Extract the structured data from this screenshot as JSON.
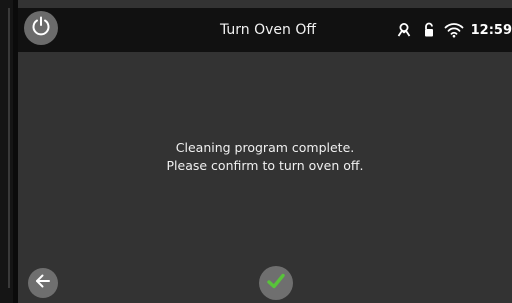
{
  "header": {
    "title": "Turn Oven Off",
    "time": "12:59"
  },
  "icons": {
    "power": "power-icon",
    "user": "user-icon",
    "lock": "lock-open-icon",
    "wifi": "wifi-icon",
    "back": "arrow-left-icon",
    "confirm": "checkmark-icon"
  },
  "message": {
    "line1": "Cleaning program complete.",
    "line2": "Please confirm to turn oven off."
  },
  "colors": {
    "screen_bg": "#333333",
    "header_bg": "#111111",
    "button_bg": "#6f6f6f",
    "confirm_check": "#58c33a"
  }
}
